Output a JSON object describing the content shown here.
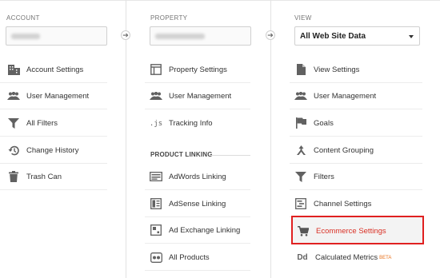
{
  "columns": {
    "account": {
      "title": "ACCOUNT",
      "items": [
        {
          "label": "Account Settings",
          "icon": "building-icon"
        },
        {
          "label": "User Management",
          "icon": "users-icon"
        },
        {
          "label": "All Filters",
          "icon": "filter-icon"
        },
        {
          "label": "Change History",
          "icon": "history-icon"
        },
        {
          "label": "Trash Can",
          "icon": "trash-icon"
        }
      ]
    },
    "property": {
      "title": "PROPERTY",
      "items": [
        {
          "label": "Property Settings",
          "icon": "property-icon"
        },
        {
          "label": "User Management",
          "icon": "users-icon"
        },
        {
          "label": "Tracking Info",
          "icon": "js-icon",
          "glyph": ".js"
        }
      ],
      "section_title": "PRODUCT LINKING",
      "linking_items": [
        {
          "label": "AdWords Linking",
          "icon": "adwords-icon"
        },
        {
          "label": "AdSense Linking",
          "icon": "adsense-icon"
        },
        {
          "label": "Ad Exchange Linking",
          "icon": "adexchange-icon"
        },
        {
          "label": "All Products",
          "icon": "all-products-icon"
        }
      ]
    },
    "view": {
      "title": "VIEW",
      "selected_view": "All Web Site Data",
      "items": [
        {
          "label": "View Settings",
          "icon": "document-icon"
        },
        {
          "label": "User Management",
          "icon": "users-icon"
        },
        {
          "label": "Goals",
          "icon": "flag-icon"
        },
        {
          "label": "Content Grouping",
          "icon": "content-grouping-icon"
        },
        {
          "label": "Filters",
          "icon": "filter-icon"
        },
        {
          "label": "Channel Settings",
          "icon": "channel-icon"
        },
        {
          "label": "Ecommerce Settings",
          "icon": "cart-icon",
          "highlighted": true
        },
        {
          "label": "Calculated Metrics",
          "icon": "dd-icon",
          "glyph": "Dd",
          "badge": "BETA"
        }
      ]
    }
  },
  "colors": {
    "highlight_border": "#e02020",
    "highlight_text": "#d93025",
    "beta": "#e8711c",
    "icon": "#616161"
  }
}
